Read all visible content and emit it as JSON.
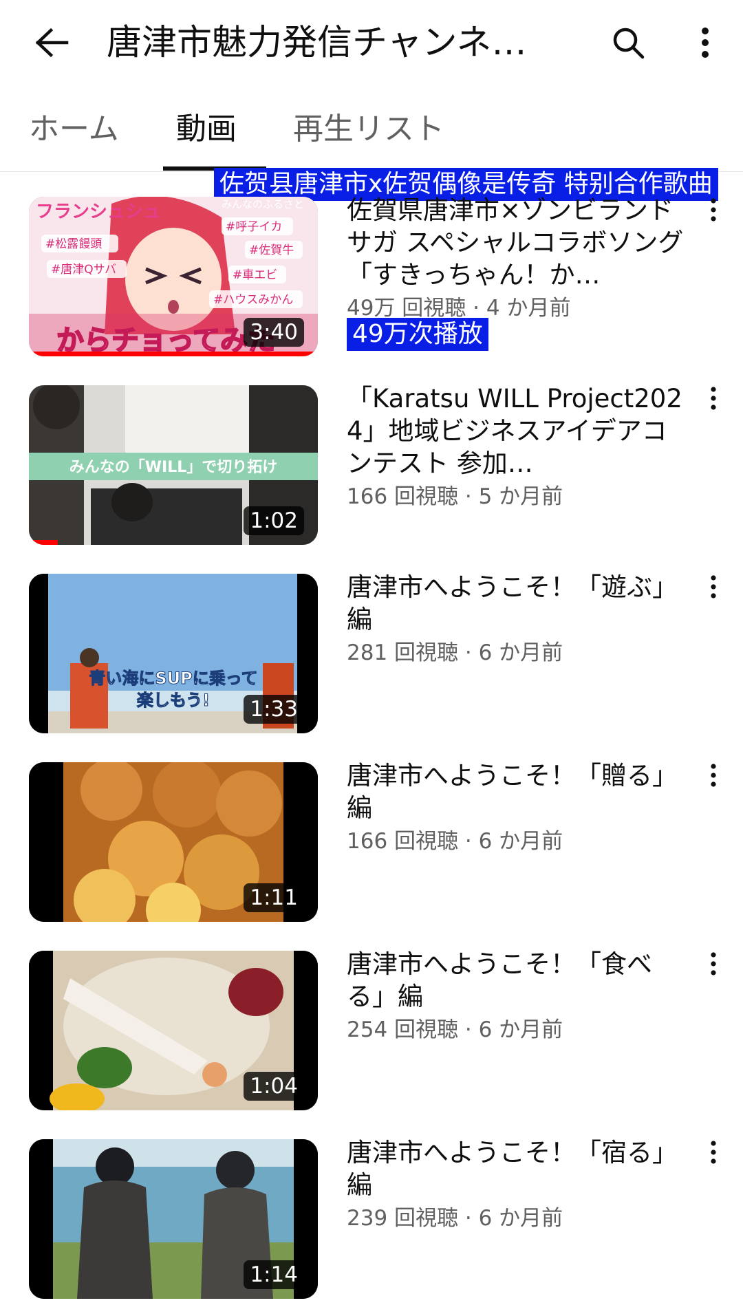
{
  "header": {
    "title": "唐津市魅力発信チャンネル【唐津市公式】",
    "back_icon": "arrow-left-icon",
    "search_icon": "search-icon",
    "more_icon": "more-vert-icon"
  },
  "tabs": [
    {
      "label": "ホーム",
      "active": false
    },
    {
      "label": "動画",
      "active": true
    },
    {
      "label": "再生リスト",
      "active": false
    }
  ],
  "overlays": {
    "top_caption": "佐贺县唐津市x佐贺偶像是传奇 特别合作歌曲",
    "views_caption": "49万次播放"
  },
  "colors": {
    "overlay_bg": "#0a1fe6",
    "progress": "#ff0000"
  },
  "videos": [
    {
      "title": "佐賀県唐津市×ゾンビランドサガ スペシャルコラボソング「すきっちゃん！か…",
      "stats": "49万 回視聴 · 4 か月前",
      "duration": "3:40",
      "thumb_texts": [
        "フランシュシュ",
        "#松露饅頭",
        "#唐津Qサバ",
        "#呼子イカ",
        "#佐賀牛",
        "#車エビ",
        "#ハウスみかん",
        "みんなのふるさと",
        "からチョってみた"
      ],
      "watch_progress": 1.0
    },
    {
      "title": "「Karatsu WILL Project2024」地域ビジネスアイデアコンテスト 参加…",
      "stats": "166 回視聴 · 5 か月前",
      "duration": "1:02",
      "thumb_texts": [
        "みんなの「WILL」で切り拓け"
      ],
      "watch_progress": 0.1
    },
    {
      "title": "唐津市へようこそ！「遊ぶ」編",
      "stats": "281 回視聴 · 6 か月前",
      "duration": "1:33",
      "thumb_texts": [
        "青い海にSUPに乗って",
        "楽しもう!"
      ]
    },
    {
      "title": "唐津市へようこそ！「贈る」編",
      "stats": "166 回視聴 · 6 か月前",
      "duration": "1:11"
    },
    {
      "title": "唐津市へようこそ！「食べる」編",
      "stats": "254 回視聴 · 6 か月前",
      "duration": "1:04"
    },
    {
      "title": "唐津市へようこそ！「宿る」編",
      "stats": "239 回視聴 · 6 か月前",
      "duration": "1:14"
    }
  ]
}
